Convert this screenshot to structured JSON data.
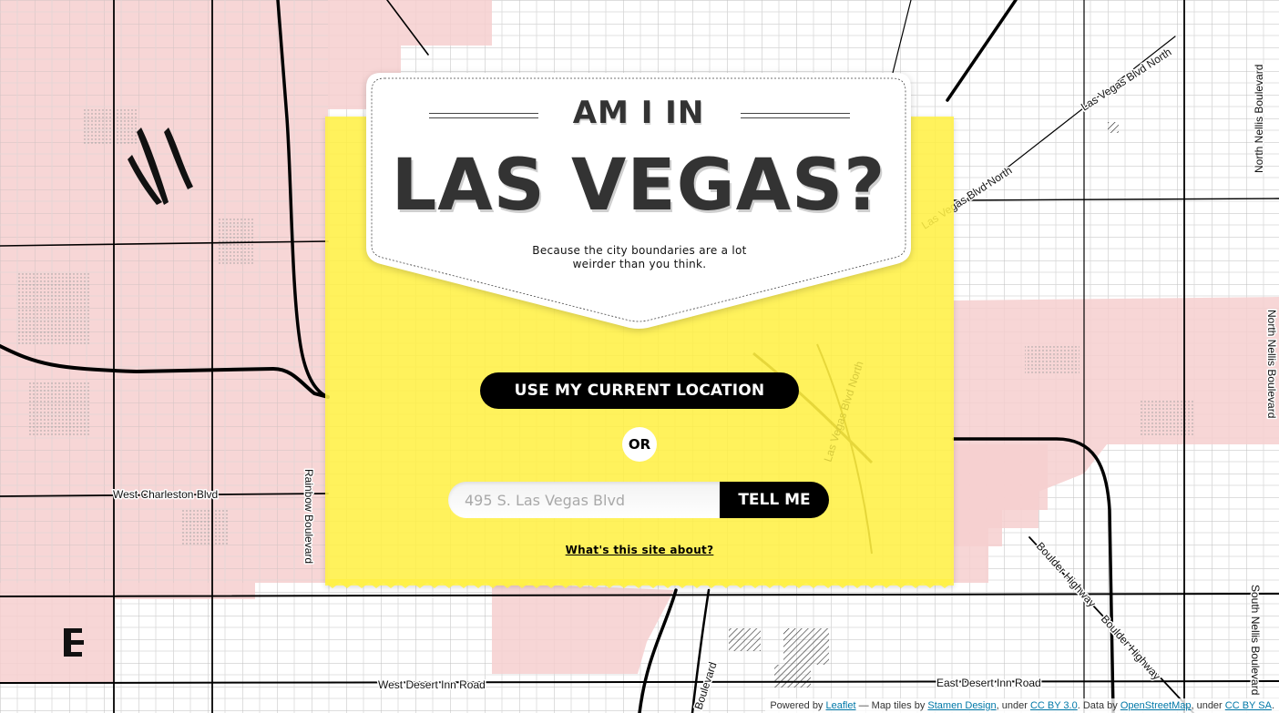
{
  "hero": {
    "kicker": "AM I IN",
    "title": "LAS VEGAS?",
    "tagline": "Because the city boundaries are a lot weirder than you think."
  },
  "actions": {
    "locate_label": "USE MY CURRENT LOCATION",
    "or_label": "OR",
    "address_placeholder": "495 S. Las Vegas Blvd",
    "address_value": "",
    "submit_label": "TELL ME",
    "about_label": "What's this site about?"
  },
  "map": {
    "street_labels": [
      "Las Vegas Blvd North",
      "Las Vegas Blvd North",
      "North Nellis Boulevard",
      "North Nellis Boulevard",
      "West Charleston Blvd",
      "Rainbow Boulevard",
      "Boulder Highway",
      "Boulder Highway",
      "West Desert Inn Road",
      "East Desert Inn Road",
      "South Nellis Boulevard",
      "Boulevard",
      "Las Vegas Blvd North"
    ],
    "colors": {
      "city_fill": "#f6cfcf",
      "panel": "#fff046",
      "road": "#000000",
      "grid": "#bdbdbd"
    }
  },
  "attribution": {
    "powered_by": "Powered by",
    "leaflet": "Leaflet",
    "tiles_by": "— Map tiles by",
    "stamen": "Stamen Design",
    "under": ", under",
    "cc_by": "CC BY 3.0",
    "data_by": ". Data by",
    "osm": "OpenStreetMap",
    "under2": ", under",
    "cc_by_sa": "CC BY SA",
    "end": "."
  }
}
